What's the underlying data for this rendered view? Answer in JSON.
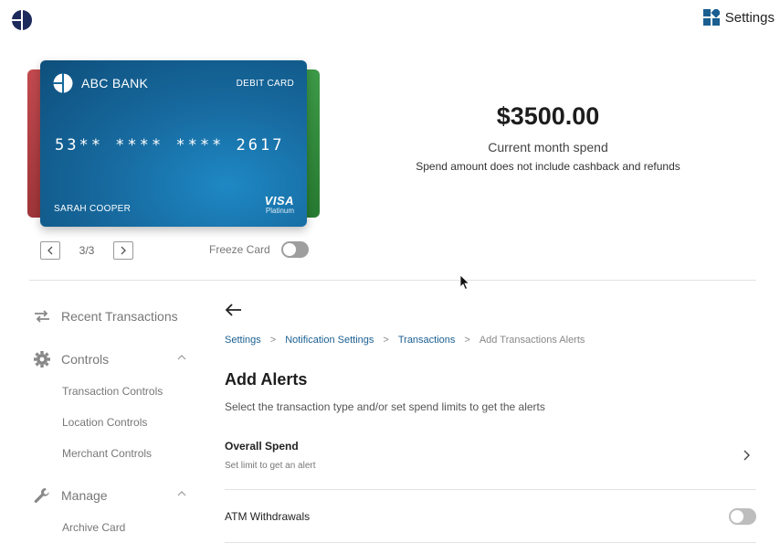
{
  "header": {
    "logo_icon": "bank-logo-icon",
    "settings_label": "Settings",
    "settings_icon": "dashboard-grid-icon"
  },
  "card": {
    "bank_name": "ABC BANK",
    "card_type": "DEBIT CARD",
    "number": "53** **** **** 2617",
    "holder": "SARAH COOPER",
    "brand": "VISA",
    "tier": "Platinum",
    "colors": {
      "main": "#176a9f",
      "back_left": "#c24a4e",
      "back_right": "#3d9a47"
    }
  },
  "pager": {
    "count": "3/3",
    "prev_icon": "chevron-left-icon",
    "next_icon": "chevron-right-icon"
  },
  "freeze": {
    "label": "Freeze Card",
    "enabled": false
  },
  "spend": {
    "amount": "$3500.00",
    "label": "Current month spend",
    "note": "Spend amount does not include cashback and refunds"
  },
  "sidebar": {
    "recent": {
      "label": "Recent Transactions",
      "icon": "swap-arrows-icon"
    },
    "controls": {
      "label": "Controls",
      "icon": "gear-icon",
      "items": [
        "Transaction Controls",
        "Location Controls",
        "Merchant Controls"
      ]
    },
    "manage": {
      "label": "Manage",
      "icon": "wrench-icon",
      "items": [
        "Archive Card"
      ]
    }
  },
  "breadcrumb": {
    "items": [
      "Settings",
      "Notification Settings",
      "Transactions"
    ],
    "current": "Add Transactions Alerts",
    "separator": ">"
  },
  "main": {
    "title": "Add Alerts",
    "subtitle": "Select the transaction type and/or set spend limits to get the alerts",
    "overall": {
      "title": "Overall Spend",
      "desc": "Set limit to get an alert"
    },
    "atm": {
      "label": "ATM Withdrawals",
      "enabled": false
    }
  },
  "colors": {
    "link": "#1b5f91",
    "accent": "#176a9f"
  }
}
